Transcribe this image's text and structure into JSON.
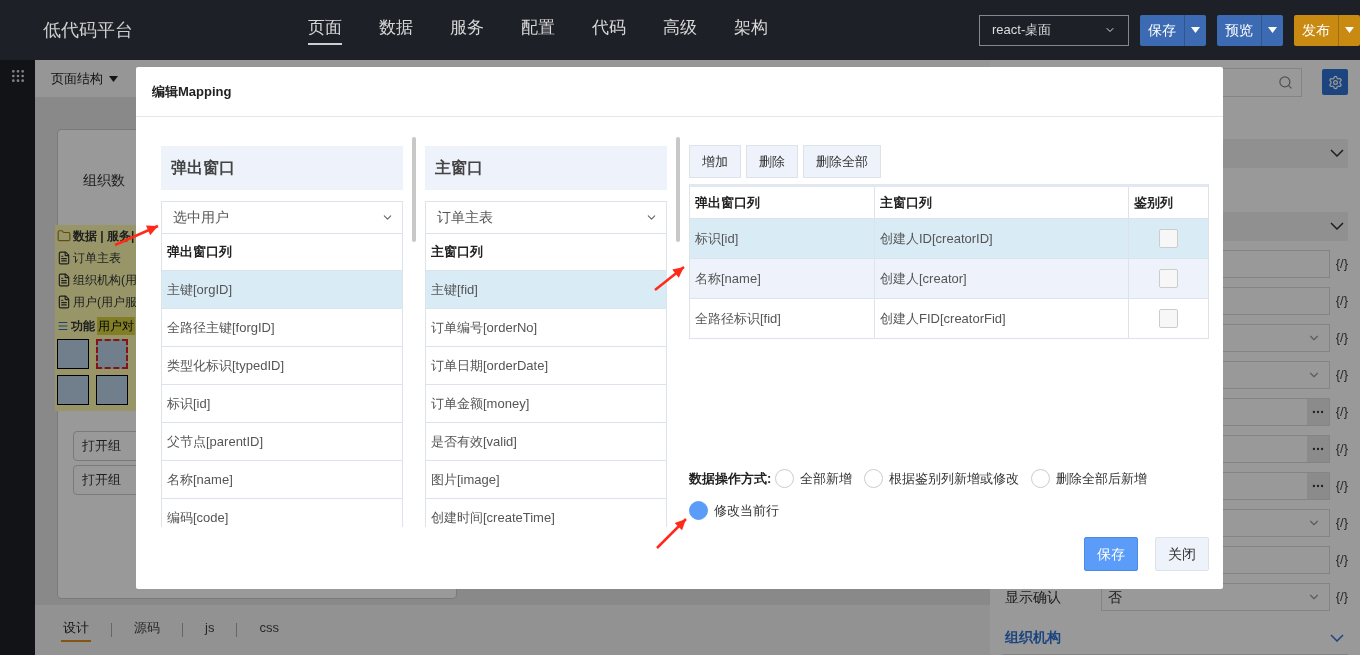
{
  "topbar": {
    "logo": "低代码平台",
    "nav": [
      {
        "label": "页面",
        "selected": true
      },
      {
        "label": "数据",
        "selected": false
      },
      {
        "label": "服务",
        "selected": false
      },
      {
        "label": "配置",
        "selected": false
      },
      {
        "label": "代码",
        "selected": false
      },
      {
        "label": "高级",
        "selected": false
      },
      {
        "label": "架构",
        "selected": false
      }
    ],
    "platform": "react-桌面",
    "buttons": [
      {
        "label": "保存",
        "color": "#3d6bb3"
      },
      {
        "label": "预览",
        "color": "#3d6bb3"
      },
      {
        "label": "发布",
        "color": "#c98a12"
      }
    ]
  },
  "designer": {
    "toolbar": "页面结构",
    "card_title": "组织数",
    "panel_header": "数据 | 服务|",
    "data_items": [
      "订单主表",
      "组织机构(用",
      "用户(用户服"
    ],
    "function_label": "功能",
    "function_tag": "用户对",
    "tiles": [
      {
        "selected": false
      },
      {
        "selected": true
      },
      {
        "selected": false
      },
      {
        "selected": false
      }
    ],
    "buttons": [
      "打开组",
      "打开组"
    ],
    "tabs": [
      {
        "label": "设计",
        "selected": true
      },
      {
        "label": "源码",
        "selected": false
      },
      {
        "label": "js",
        "selected": false
      },
      {
        "label": "css",
        "selected": false
      }
    ]
  },
  "properties": {
    "rows": [
      {
        "kind": "text",
        "code": "{/}"
      },
      {
        "kind": "text",
        "code": "{/}"
      },
      {
        "kind": "select",
        "code": "{/}"
      },
      {
        "kind": "select",
        "code": "{/}"
      },
      {
        "kind": "picker",
        "code": "{/}"
      },
      {
        "kind": "picker",
        "code": "{/}"
      },
      {
        "kind": "picker",
        "code": "{/}"
      },
      {
        "kind": "select",
        "code": "{/}"
      },
      {
        "kind": "text",
        "code": "{/}"
      },
      {
        "kind": "select",
        "label": "显示确认",
        "value": "否",
        "code": "{/}"
      }
    ],
    "section": "组织机构"
  },
  "dialog": {
    "title": "编辑Mapping",
    "lists": [
      {
        "title": "弹出窗口",
        "source": "选中用户",
        "column_header": "弹出窗口列",
        "items": [
          {
            "label": "主键[orgID]",
            "selected": true
          },
          {
            "label": "全路径主键[forgID]",
            "selected": false
          },
          {
            "label": "类型化标识[typedID]",
            "selected": false
          },
          {
            "label": "标识[id]",
            "selected": false
          },
          {
            "label": "父节点[parentID]",
            "selected": false
          },
          {
            "label": "名称[name]",
            "selected": false
          },
          {
            "label": "编码[code]",
            "selected": false
          }
        ]
      },
      {
        "title": "主窗口",
        "source": "订单主表",
        "column_header": "主窗口列",
        "items": [
          {
            "label": "主键[fid]",
            "selected": true
          },
          {
            "label": "订单编号[orderNo]",
            "selected": false
          },
          {
            "label": "订单日期[orderDate]",
            "selected": false
          },
          {
            "label": "订单金额[money]",
            "selected": false
          },
          {
            "label": "是否有效[valid]",
            "selected": false
          },
          {
            "label": "图片[image]",
            "selected": false
          },
          {
            "label": "创建时间[createTime]",
            "selected": false
          }
        ]
      }
    ],
    "actions": [
      "增加",
      "删除",
      "删除全部"
    ],
    "table": {
      "columns": [
        "弹出窗口列",
        "主窗口列",
        "鉴别列"
      ],
      "rows": [
        {
          "popup": "标识[id]",
          "main": "创建人ID[creatorID]",
          "key": false,
          "selected": true,
          "hovered": false
        },
        {
          "popup": "名称[name]",
          "main": "创建人[creator]",
          "key": false,
          "selected": false,
          "hovered": true
        },
        {
          "popup": "全路径标识[fid]",
          "main": "创建人FID[creatorFid]",
          "key": false,
          "selected": false,
          "hovered": false
        }
      ]
    },
    "mode_label": "数据操作方式:",
    "modes": [
      {
        "label": "全部新增",
        "selected": false
      },
      {
        "label": "根据鉴别列新增或修改",
        "selected": false
      },
      {
        "label": "删除全部后新增",
        "selected": false
      },
      {
        "label": "修改当前行",
        "selected": true
      }
    ],
    "buttons": [
      {
        "label": "保存",
        "kind": "primary"
      },
      {
        "label": "关闭",
        "kind": "default"
      }
    ]
  }
}
